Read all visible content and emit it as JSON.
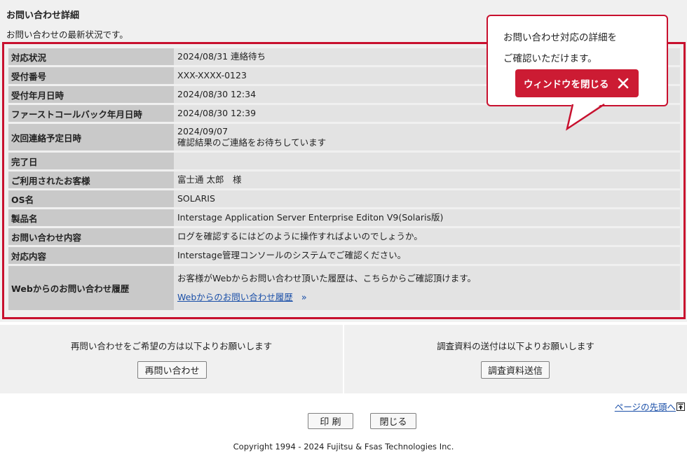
{
  "header": {
    "title": "お問い合わせ詳細",
    "subtitle": "お問い合わせの最新状況です。"
  },
  "rows": [
    {
      "label": "対応状況",
      "values": [
        "2024/08/31 連絡待ち"
      ]
    },
    {
      "label": "受付番号",
      "values": [
        "XXX-XXXX-0123"
      ]
    },
    {
      "label": "受付年月日時",
      "values": [
        "2024/08/30 12:34"
      ]
    },
    {
      "label": "ファーストコールバック年月日時",
      "values": [
        "2024/08/30 12:39"
      ]
    },
    {
      "label": "次回連絡予定日時",
      "values": [
        "2024/09/07",
        "確認結果のご連絡をお待ちしています"
      ]
    },
    {
      "label": "完了日",
      "values": [
        ""
      ]
    },
    {
      "label": "ご利用されたお客様",
      "values": [
        "富士通 太郎　様"
      ]
    },
    {
      "label": "OS名",
      "values": [
        "SOLARIS"
      ]
    },
    {
      "label": "製品名",
      "values": [
        "Interstage Application Server Enterprise Editon V9(Solaris版)"
      ]
    },
    {
      "label": "お問い合わせ内容",
      "values": [
        "ログを確認するにはどのように操作すればよいのでしょうか。"
      ]
    },
    {
      "label": "対応内容",
      "values": [
        "Interstage管理コンソールのシステムでご確認ください。"
      ]
    },
    {
      "label": "Webからのお問い合わせ履歴",
      "values": [
        "お客様がWebからお問い合わせ頂いた履歴は、こちらからご確認頂けます。"
      ],
      "link": "Webからのお問い合わせ履歴"
    }
  ],
  "balloon": {
    "line1": "お問い合わせ対応の詳細を",
    "line2": "ご確認いただけます。",
    "close_label": "ウィンドウを閉じる",
    "close_icon": "close-icon"
  },
  "bottom": {
    "left_text": "再問い合わせをご希望の方は以下よりお願いします",
    "left_button": "再問い合わせ",
    "right_text": "調査資料の送付は以下よりお願いします",
    "right_button": "調査資料送信"
  },
  "footer": {
    "pagetop": "ページの先頭へ",
    "print_button": "印 刷",
    "close_button": "閉じる",
    "copyright": "Copyright 1994 - 2024 Fujitsu & Fsas Technologies Inc."
  },
  "colors": {
    "accent_red": "#c8102e",
    "label_bg": "#c9c9c9",
    "value_bg": "#e3e3e3",
    "link": "#1a4fa8"
  }
}
